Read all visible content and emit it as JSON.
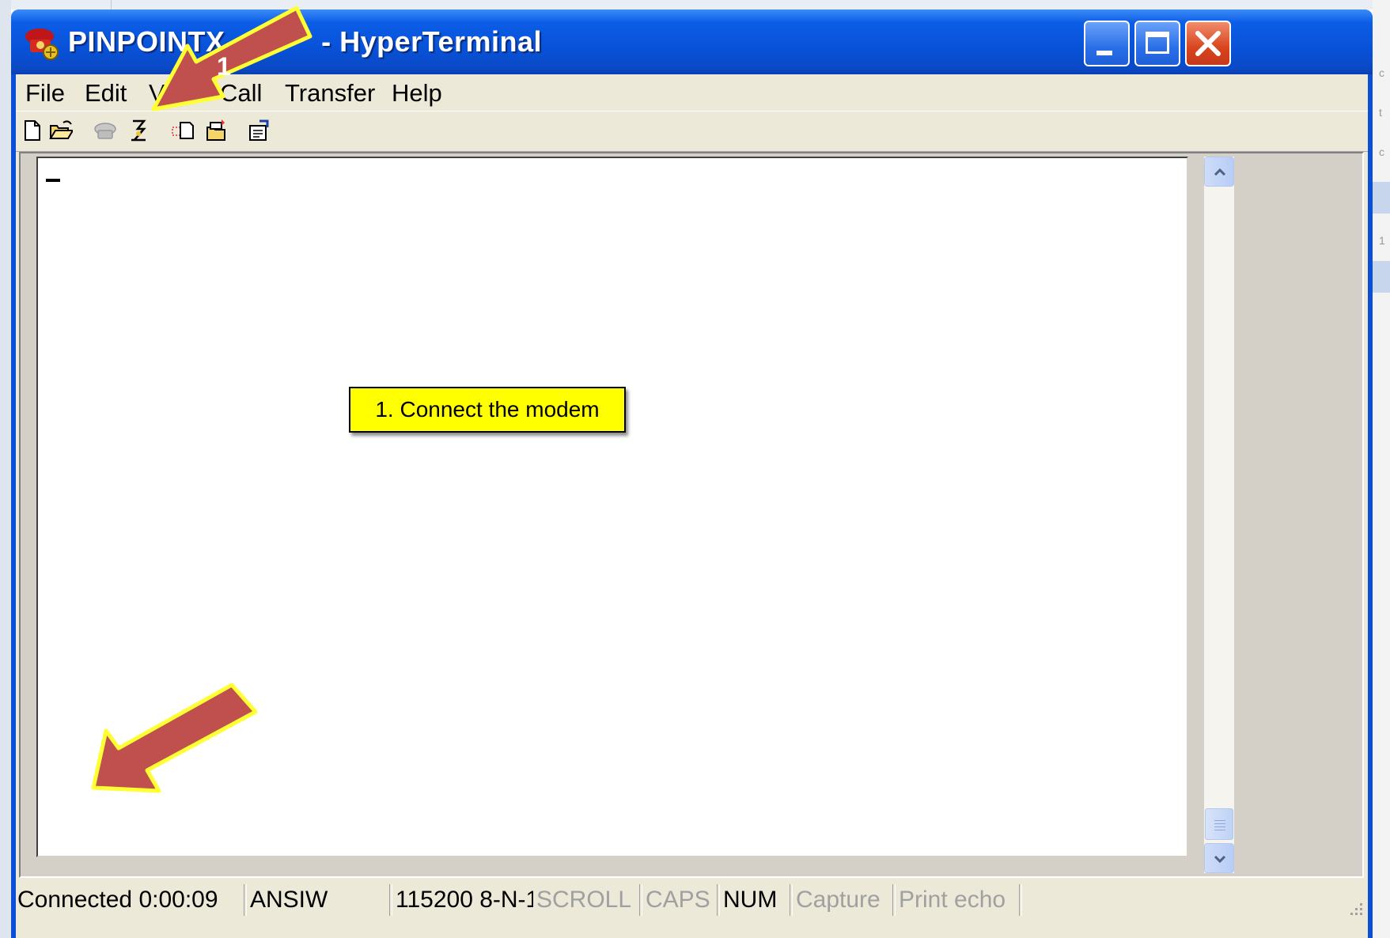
{
  "window": {
    "title": "PINPOINTX_15...- HyperTerminal",
    "title_visible": "PINPOINTX_15",
    "title_suffix": "- HyperTerminal",
    "controls": [
      "minimize",
      "maximize",
      "close"
    ]
  },
  "menu": {
    "items": [
      "File",
      "Edit",
      "V",
      "Call",
      "Transfer",
      "Help"
    ]
  },
  "toolbar": {
    "icons": [
      "new-icon",
      "open-icon",
      "disconnect-icon",
      "connect-icon",
      "send-icon",
      "receive-icon",
      "properties-icon"
    ]
  },
  "terminal": {
    "cursor": "_"
  },
  "statusbar": {
    "connection": "Connected 0:00:09",
    "emulation": "ANSIW",
    "port_settings": "115200 8-N-1",
    "scroll": "SCROLL",
    "caps": "CAPS",
    "num": "NUM",
    "capture": "Capture",
    "print_echo": "Print echo"
  },
  "annotations": {
    "callout": "1. Connect the modem",
    "arrow_label": "1",
    "arrow_color": "#c0504d",
    "arrow_outline": "#ffff33",
    "callout_bg": "#ffff00"
  },
  "colors": {
    "titlebar": "#0a4fd6",
    "client_bg": "#ece9d8",
    "close_button": "#d8451e"
  }
}
